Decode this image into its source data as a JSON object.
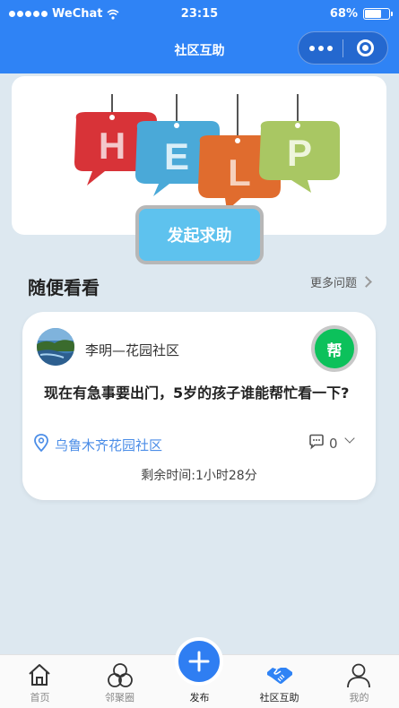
{
  "status_bar": {
    "carrier": "WeChat",
    "time": "23:15",
    "battery": "68%",
    "battery_level": 0.68
  },
  "nav": {
    "title": "社区互助"
  },
  "banner": {
    "letters": [
      "H",
      "E",
      "L",
      "P"
    ]
  },
  "cta": {
    "label": "发起求助"
  },
  "section": {
    "title": "随便看看",
    "more_label": "更多问题"
  },
  "post": {
    "author": "李明—花园社区",
    "badge": "帮",
    "body": "现在有急事要出门，5岁的孩子谁能帮忙看一下?",
    "location": "乌鲁木齐花园社区",
    "comments": "0",
    "time_left": "剩余时间:1小时28分"
  },
  "tabs": [
    {
      "label": "首页",
      "icon": "home-icon"
    },
    {
      "label": "邻聚圈",
      "icon": "circles-icon"
    },
    {
      "label": "发布",
      "icon": "plus-icon"
    },
    {
      "label": "社区互助",
      "icon": "handshake-icon"
    },
    {
      "label": "我的",
      "icon": "user-icon"
    }
  ],
  "colors": {
    "primary": "#2f83f5",
    "cta": "#5ec2ee",
    "badge": "#0cc15b",
    "location": "#4b8de7"
  }
}
